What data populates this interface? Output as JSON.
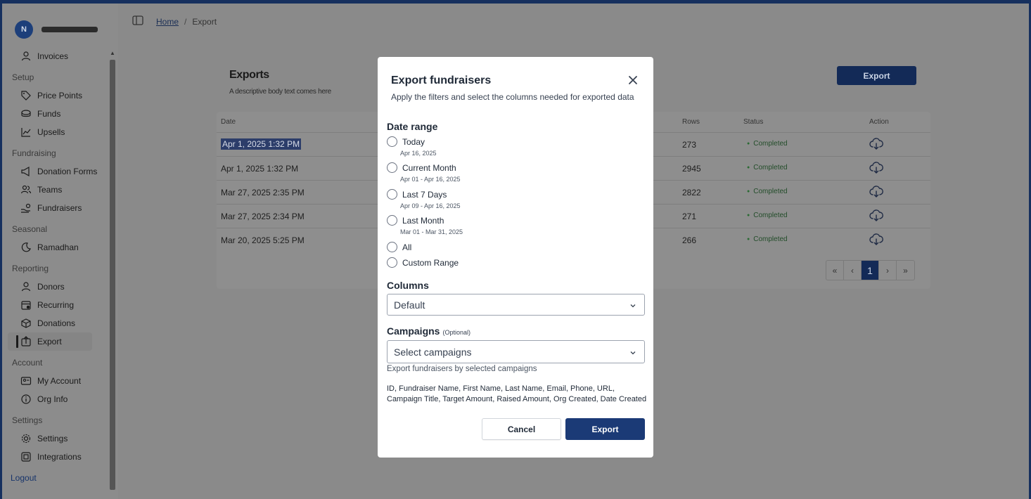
{
  "breadcrumb": {
    "home": "Home",
    "separator": "/",
    "current": "Export"
  },
  "brand": {
    "avatar_initial": "N"
  },
  "sidebar": {
    "top_items": [
      {
        "label": "Invoices",
        "icon": "user-icon"
      }
    ],
    "sections": [
      {
        "title": "Setup",
        "items": [
          {
            "label": "Price Points",
            "icon": "tag-icon"
          },
          {
            "label": "Funds",
            "icon": "coins-icon"
          },
          {
            "label": "Upsells",
            "icon": "chart-line-icon"
          }
        ]
      },
      {
        "title": "Fundraising",
        "items": [
          {
            "label": "Donation Forms",
            "icon": "megaphone-icon"
          },
          {
            "label": "Teams",
            "icon": "users-icon"
          },
          {
            "label": "Fundraisers",
            "icon": "hand-coins-icon"
          }
        ]
      },
      {
        "title": "Seasonal",
        "items": [
          {
            "label": "Ramadhan",
            "icon": "moon-icon"
          }
        ]
      },
      {
        "title": "Reporting",
        "items": [
          {
            "label": "Donors",
            "icon": "user-icon"
          },
          {
            "label": "Recurring",
            "icon": "calendar-repeat-icon"
          },
          {
            "label": "Donations",
            "icon": "box-icon"
          },
          {
            "label": "Export",
            "icon": "export-icon"
          }
        ]
      },
      {
        "title": "Account",
        "items": [
          {
            "label": "My Account",
            "icon": "id-card-icon"
          },
          {
            "label": "Org Info",
            "icon": "info-icon"
          }
        ]
      },
      {
        "title": "Settings",
        "items": [
          {
            "label": "Settings",
            "icon": "gear-icon"
          },
          {
            "label": "Integrations",
            "icon": "plug-icon"
          }
        ]
      }
    ],
    "active": "Export",
    "logout": "Logout"
  },
  "panel": {
    "title": "Exports",
    "subtitle": "A descriptive body text comes here",
    "export_button": "Export",
    "columns": {
      "date": "Date",
      "rows": "Rows",
      "status": "Status",
      "action": "Action"
    },
    "rows": [
      {
        "date": "Apr 1, 2025 1:32 PM",
        "rows": "273",
        "status": "Completed"
      },
      {
        "date": "Apr 1, 2025 1:32 PM",
        "rows": "2945",
        "status": "Completed"
      },
      {
        "date": "Mar 27, 2025 2:35 PM",
        "rows": "2822",
        "status": "Completed"
      },
      {
        "date": "Mar 27, 2025 2:34 PM",
        "rows": "271",
        "status": "Completed"
      },
      {
        "date": "Mar 20, 2025 5:25 PM",
        "rows": "266",
        "status": "Completed"
      }
    ],
    "pagination": {
      "first": "«",
      "prev": "‹",
      "current": "1",
      "next": "›",
      "last": "»"
    }
  },
  "modal": {
    "title": "Export fundraisers",
    "subtitle": "Apply the filters and select the columns needed for exported data",
    "date_range_title": "Date range",
    "date_options": [
      {
        "label": "Today",
        "hint": "Apr 16, 2025"
      },
      {
        "label": "Current Month",
        "hint": "Apr 01 - Apr 16, 2025"
      },
      {
        "label": "Last 7 Days",
        "hint": "Apr 09 - Apr 16, 2025"
      },
      {
        "label": "Last Month",
        "hint": "Mar 01 - Mar 31, 2025"
      },
      {
        "label": "All",
        "hint": ""
      },
      {
        "label": "Custom Range",
        "hint": ""
      }
    ],
    "columns_title": "Columns",
    "columns_value": "Default",
    "campaigns_title": "Campaigns",
    "campaigns_optional": "(Optional)",
    "campaigns_placeholder": "Select campaigns",
    "campaigns_help": "Export fundraisers by selected campaigns",
    "fields_list": "ID, Fundraiser Name, First Name, Last Name, Email, Phone, URL, Campaign Title, Target Amount, Raised Amount, Org Created, Date Created",
    "cancel": "Cancel",
    "export": "Export"
  },
  "colors": {
    "primary": "#1b3a76",
    "overlay": "#8a8a8a",
    "status_green": "#2b6b34"
  }
}
